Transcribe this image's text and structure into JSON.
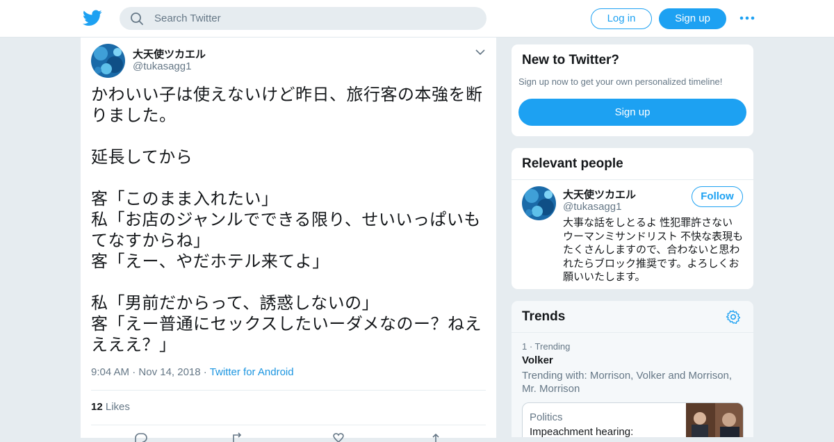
{
  "header": {
    "search_placeholder": "Search Twitter",
    "login_label": "Log in",
    "signup_label": "Sign up",
    "brand_color": "#1da1f2"
  },
  "tweet": {
    "author_name": "大天使ツカエル",
    "author_handle": "@tukasagg1",
    "text": "かわいい子は使えないけど昨日、旅行客の本強を断りました。\n\n延長してから\n\n客「このまま入れたい」\n私「お店のジャンルでできる限り、せいいっぱいもてなすからね」\n客「えー、やだホテル来てよ」\n\n私「男前だからって、誘惑しないの」\n客「えー普通にセックスしたいーダメなのー？ねええええ？」",
    "time": "9:04 AM",
    "date": "Nov 14, 2018",
    "source": "Twitter for Android",
    "likes_count": "12",
    "likes_label": "Likes"
  },
  "sidebar": {
    "new": {
      "title": "New to Twitter?",
      "subtitle": "Sign up now to get your own personalized timeline!",
      "signup_label": "Sign up"
    },
    "relevant": {
      "title": "Relevant people",
      "name": "大天使ツカエル",
      "handle": "@tukasagg1",
      "follow_label": "Follow",
      "bio": "大事な話をしとるよ 性犯罪許さない ウーマンミサンドリスト 不快な表現もたくさんしますので、合わないと思われたらブロック推奨です。よろしくお願いいたします。"
    },
    "trends": {
      "title": "Trends",
      "items": [
        {
          "rank": "1 · Trending",
          "name": "Volker",
          "with": "Trending with: Morrison, Volker and Morrison, Mr. Morrison",
          "news_category": "Politics",
          "news_headline": "Impeachment hearing:"
        }
      ]
    }
  }
}
